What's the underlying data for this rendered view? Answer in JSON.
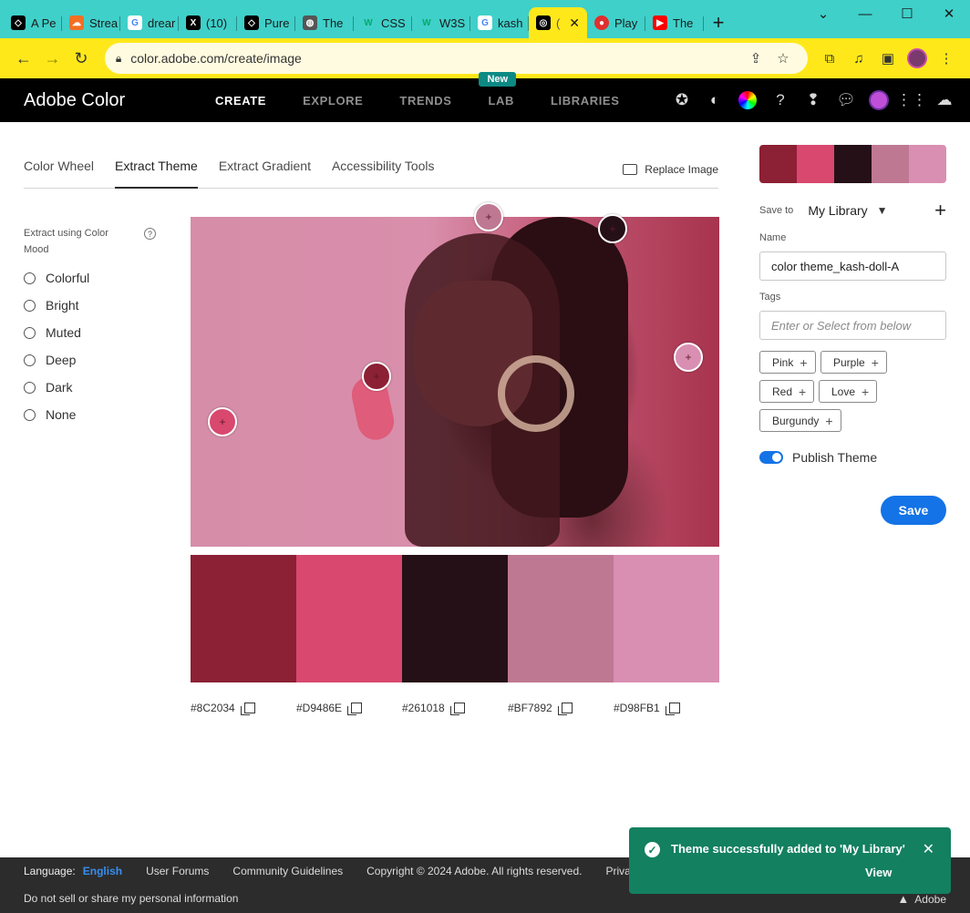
{
  "browser": {
    "tabs": [
      {
        "label": "A Pe",
        "icon": "codepen-icon",
        "color": "#000000"
      },
      {
        "label": "Strea",
        "icon": "soundcloud-icon",
        "color": "#f26f23"
      },
      {
        "label": "drear",
        "icon": "google-icon",
        "color": "#4285f4"
      },
      {
        "label": "(10) ",
        "icon": "x-icon",
        "color": "#000000"
      },
      {
        "label": "Pure",
        "icon": "codepen-icon",
        "color": "#000000"
      },
      {
        "label": "The",
        "icon": "globe-icon",
        "color": "#555555"
      },
      {
        "label": "CSS",
        "icon": "w3schools-icon",
        "color": "#04aa6d"
      },
      {
        "label": "W3S",
        "icon": "w3schools-icon",
        "color": "#04aa6d"
      },
      {
        "label": "kash",
        "icon": "google-icon",
        "color": "#4285f4"
      },
      {
        "label": "(",
        "icon": "adobe-color-icon",
        "color": "#000000",
        "active": true
      },
      {
        "label": "Play",
        "icon": "app-icon",
        "color": "#e02f2f"
      },
      {
        "label": "The",
        "icon": "youtube-icon",
        "color": "#ff0000"
      }
    ],
    "url": "color.adobe.com/create/image"
  },
  "header": {
    "brand": "Adobe Color",
    "nav": [
      "CREATE",
      "EXPLORE",
      "TRENDS",
      "LAB",
      "LIBRARIES"
    ],
    "new_badge": "New"
  },
  "subtabs": [
    "Color Wheel",
    "Extract Theme",
    "Extract Gradient",
    "Accessibility Tools"
  ],
  "replace_image": "Replace Image",
  "mood": {
    "heading": "Extract using Color Mood",
    "options": [
      "Colorful",
      "Bright",
      "Muted",
      "Deep",
      "Dark",
      "None"
    ]
  },
  "swatches": [
    {
      "hex": "#8C2034"
    },
    {
      "hex": "#D9486E"
    },
    {
      "hex": "#261018"
    },
    {
      "hex": "#BF7892"
    },
    {
      "hex": "#D98FB1"
    }
  ],
  "panel": {
    "save_to_label": "Save to",
    "library": "My Library",
    "name_label": "Name",
    "name_value": "color theme_kash-doll-A",
    "tags_label": "Tags",
    "tags_placeholder": "Enter or Select from below",
    "tags": [
      "Pink",
      "Purple",
      "Red",
      "Love",
      "Burgundy"
    ],
    "publish": "Publish Theme",
    "save": "Save"
  },
  "footer": {
    "language_label": "Language:",
    "language": "English",
    "links": [
      "User Forums",
      "Community Guidelines",
      "Copyright © 2024 Adobe. All rights reserved.",
      "Privacy"
    ],
    "dnsmpi": "Do not sell or share my personal information",
    "adobe": "Adobe"
  },
  "toast": {
    "message": "Theme successfully added to 'My Library'",
    "action": "View"
  }
}
